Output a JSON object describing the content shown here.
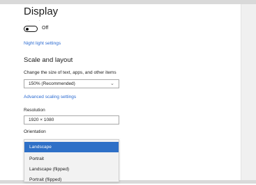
{
  "header": {
    "title": "Display",
    "dots": "· ·"
  },
  "night_light": {
    "toggle_state": "Off",
    "link": "Night light settings"
  },
  "scale_layout": {
    "title": "Scale and layout",
    "scale_label": "Change the size of text, apps, and other items",
    "scale_value": "150% (Recommended)",
    "advanced_link": "Advanced scaling settings",
    "resolution_label": "Resolution",
    "resolution_value": "1920 × 1080",
    "orientation_label": "Orientation",
    "orientation_options": [
      "Landscape",
      "Portrait",
      "Landscape (flipped)",
      "Portrait (flipped)"
    ],
    "orientation_selected": "Landscape"
  },
  "icons": {
    "chevron": "chevron-down-icon"
  },
  "colors": {
    "accent": "#2e70c7",
    "link": "#2a6ad1"
  }
}
